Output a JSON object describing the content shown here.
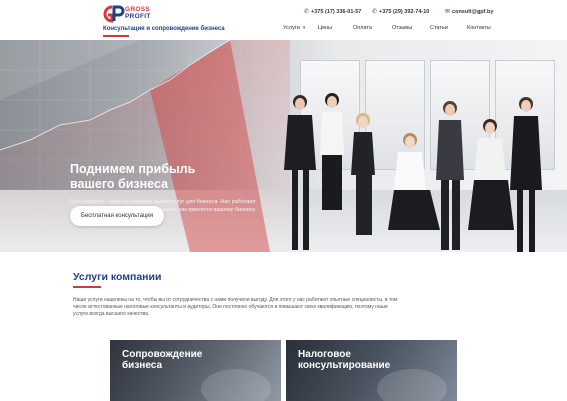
{
  "brand": {
    "name_line1": "GROSS",
    "name_line2": "PROFIT",
    "tagline": "Консультация и сопровождение бизнеса",
    "accent_color": "#d23a3a",
    "primary_color": "#1f3f8c"
  },
  "header": {
    "contacts": [
      {
        "icon": "phone-icon",
        "text": "+375 (17) 336-01-57"
      },
      {
        "icon": "phone-icon",
        "text": "+375 (29) 392-74-10"
      },
      {
        "icon": "mail-icon",
        "text": "consult@gpf.by"
      }
    ],
    "nav": [
      {
        "label": "Услуги",
        "has_dropdown": true
      },
      {
        "label": "Цены"
      },
      {
        "label": "Оплата"
      },
      {
        "label": "Отзывы"
      },
      {
        "label": "Статьи"
      },
      {
        "label": "Контакты"
      }
    ]
  },
  "hero": {
    "title_line1": "Поднимем прибыль",
    "title_line2": "вашего бизнеса",
    "text": "Гросспрофит – один из лидеров рынка услуг для бизнеса. Нас работают уникальные специалисты, которые знают, как принести вашему бизнесу выгоду.",
    "button_label": "Бесплатная консультация"
  },
  "services": {
    "title": "Услуги компании",
    "text": "Наши услуги нацелены на то, чтобы вы от сотрудничества с нами получили выгоду. Для этого у нас работают опытные специалисты, в том числе аттестованные налоговые консультанты и аудиторы. Они постоянно обучаются и повышают свою квалификацию, поэтому наши услуги всегда высшего качества.",
    "cards": [
      {
        "title_line1": "Сопровождение",
        "title_line2": "бизнеса"
      },
      {
        "title_line1": "Налоговое",
        "title_line2": "консультирование"
      }
    ]
  }
}
